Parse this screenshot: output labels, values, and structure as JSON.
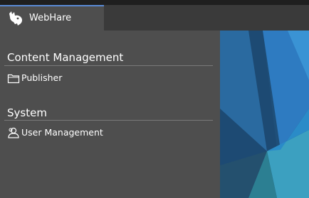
{
  "app": {
    "name": "WebHare",
    "logo_icon": "webhare-logo-icon"
  },
  "sections": [
    {
      "title": "Content Management",
      "items": [
        {
          "label": "Publisher",
          "icon": "folder-icon"
        }
      ]
    },
    {
      "title": "System",
      "items": [
        {
          "label": "User Management",
          "icon": "user-management-icon"
        }
      ]
    }
  ],
  "colors": {
    "accent": "#5a8bd6",
    "sidebar_bg": "#4e4e4e",
    "topbar_bg": "#3a3a3a",
    "text": "#ffffff"
  }
}
